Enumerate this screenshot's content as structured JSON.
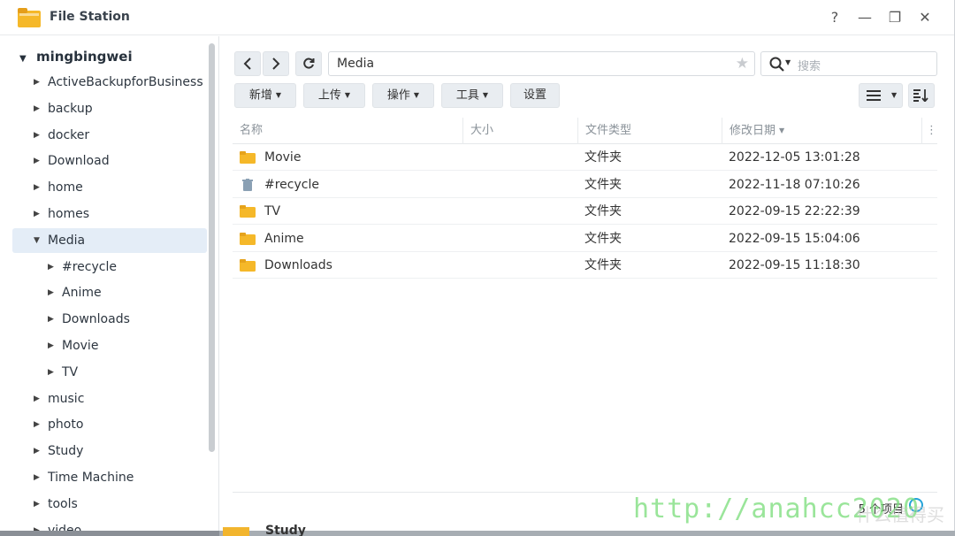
{
  "window": {
    "title": "File Station",
    "controls": [
      "?",
      "—",
      "❐",
      "✕"
    ],
    "accent": "#e4edf7",
    "folder_color": "#f5b829"
  },
  "sidebar": {
    "root": "mingbingwei",
    "items": [
      {
        "label": "ActiveBackupforBusiness",
        "level": 1,
        "expanded": false,
        "selected": false
      },
      {
        "label": "backup",
        "level": 1,
        "expanded": false,
        "selected": false
      },
      {
        "label": "docker",
        "level": 1,
        "expanded": false,
        "selected": false
      },
      {
        "label": "Download",
        "level": 1,
        "expanded": false,
        "selected": false
      },
      {
        "label": "home",
        "level": 1,
        "expanded": false,
        "selected": false
      },
      {
        "label": "homes",
        "level": 1,
        "expanded": false,
        "selected": false
      },
      {
        "label": "Media",
        "level": 1,
        "expanded": true,
        "selected": true
      },
      {
        "label": "#recycle",
        "level": 2,
        "expanded": false,
        "selected": false
      },
      {
        "label": "Anime",
        "level": 2,
        "expanded": false,
        "selected": false
      },
      {
        "label": "Downloads",
        "level": 2,
        "expanded": false,
        "selected": false
      },
      {
        "label": "Movie",
        "level": 2,
        "expanded": false,
        "selected": false
      },
      {
        "label": "TV",
        "level": 2,
        "expanded": false,
        "selected": false
      },
      {
        "label": "music",
        "level": 1,
        "expanded": false,
        "selected": false
      },
      {
        "label": "photo",
        "level": 1,
        "expanded": false,
        "selected": false
      },
      {
        "label": "Study",
        "level": 1,
        "expanded": false,
        "selected": false
      },
      {
        "label": "Time Machine",
        "level": 1,
        "expanded": false,
        "selected": false
      },
      {
        "label": "tools",
        "level": 1,
        "expanded": false,
        "selected": false
      },
      {
        "label": "video",
        "level": 1,
        "expanded": false,
        "selected": false
      }
    ]
  },
  "nav": {
    "back_icon": "chevron-left-icon",
    "forward_icon": "chevron-right-icon",
    "refresh_icon": "refresh-icon",
    "path": "Media",
    "favorite_icon": "star-icon"
  },
  "search": {
    "placeholder": "搜索"
  },
  "toolbar": {
    "buttons": [
      "新增",
      "上传",
      "操作",
      "工具",
      "设置"
    ]
  },
  "table": {
    "columns": [
      "名称",
      "大小",
      "文件类型",
      "修改日期"
    ],
    "rows": [
      {
        "name": "Movie",
        "icon": "folder-icon",
        "size": "",
        "type": "文件夹",
        "modified": "2022-12-05 13:01:28"
      },
      {
        "name": "#recycle",
        "icon": "trash-icon",
        "size": "",
        "type": "文件夹",
        "modified": "2022-11-18 07:10:26"
      },
      {
        "name": "TV",
        "icon": "folder-icon",
        "size": "",
        "type": "文件夹",
        "modified": "2022-09-15 22:22:39"
      },
      {
        "name": "Anime",
        "icon": "folder-icon",
        "size": "",
        "type": "文件夹",
        "modified": "2022-09-15 15:04:06"
      },
      {
        "name": "Downloads",
        "icon": "folder-icon",
        "size": "",
        "type": "文件夹",
        "modified": "2022-09-15 11:18:30"
      }
    ]
  },
  "footer": {
    "count": "5 个项目"
  },
  "watermark": {
    "url": "http://anahcc2020",
    "site": "什么值得买"
  },
  "background": {
    "behind_label": "Study"
  }
}
